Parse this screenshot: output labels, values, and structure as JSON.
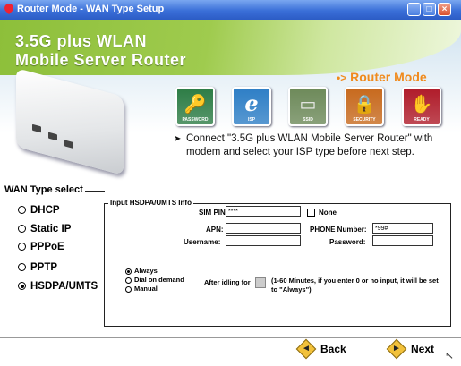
{
  "window": {
    "title": "Router Mode - WAN Type Setup",
    "buttons": [
      "_",
      "□",
      "×"
    ]
  },
  "header": {
    "product_line1": "3.5G plus WLAN",
    "product_line2": "Mobile Server Router",
    "mode_arrow": "•>",
    "mode_label": "Router Mode",
    "steps": [
      {
        "label": "PASSWORD",
        "icon": "key-icon",
        "glyph": "🔑",
        "color": "#2e7d46"
      },
      {
        "label": "ISP",
        "icon": "ie-globe-icon",
        "glyph": "e",
        "color": "#2f7fc6"
      },
      {
        "label": "SSID",
        "icon": "router-device-icon",
        "glyph": "▭",
        "color": "#6e8a5a"
      },
      {
        "label": "SECURITY",
        "icon": "lock-icon",
        "glyph": "🔒",
        "color": "#c86a1e"
      },
      {
        "label": "READY",
        "icon": "hand-icon",
        "glyph": "✋",
        "color": "#b01c2a"
      }
    ],
    "instruction": "Connect \"3.5G plus WLAN Mobile Server Router\" with modem and select  your ISP type before next step."
  },
  "wan_type": {
    "legend": "WAN Type select",
    "options": [
      {
        "label": "DHCP",
        "selected": false
      },
      {
        "label": "Static IP",
        "selected": false
      },
      {
        "label": "PPPoE",
        "selected": false
      },
      {
        "label": "PPTP",
        "selected": false
      },
      {
        "label": "HSDPA/UMTS",
        "selected": true
      }
    ]
  },
  "hsdpa": {
    "legend": "Input HSDPA/UMTS Info",
    "sim_pin_label": "SIM PIN:",
    "sim_pin_value": "****",
    "none_label": "None",
    "apn_label": "APN:",
    "apn_value": "",
    "phone_label": "PHONE Number:",
    "phone_value": "*99#",
    "username_label": "Username:",
    "username_value": "",
    "password_label": "Password:",
    "password_value": "",
    "dial_options": [
      {
        "label": "Always",
        "selected": true
      },
      {
        "label": "Dial on demand",
        "selected": false
      },
      {
        "label": "Manual",
        "selected": false
      }
    ],
    "idle_label": "After idling for",
    "idle_value": "",
    "idle_note": "(1-60 Minutes, if you enter 0 or no input, it will be set to \"Always\")"
  },
  "nav": {
    "back_label": "Back",
    "next_label": "Next",
    "back_glyph": "◄",
    "next_glyph": "►"
  },
  "colors": {
    "titlebar": "#3a6fd8",
    "header_green": "#8dbf3a",
    "router_mode_orange": "#f08a1c"
  }
}
